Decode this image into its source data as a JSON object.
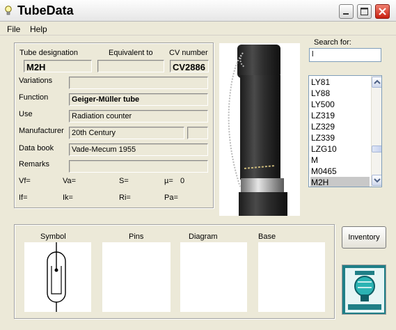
{
  "window": {
    "title": "TubeData"
  },
  "menu": {
    "file": "File",
    "help": "Help"
  },
  "labels": {
    "tube_designation": "Tube designation",
    "equivalent_to": "Equivalent to",
    "cv_number": "CV number",
    "variations": "Variations",
    "function": "Function",
    "use": "Use",
    "manufacturer": "Manufacturer",
    "data_book": "Data book",
    "remarks": "Remarks"
  },
  "values": {
    "tube_designation": "M2H",
    "equivalent_to": "",
    "cv_number": "CV2886",
    "variations": "",
    "function": "Geiger-Müller tube",
    "use": "Radiation counter",
    "manufacturer": "20th Century",
    "manufacturer_extra": "",
    "data_book": "Vade-Mecum 1955",
    "remarks": ""
  },
  "params": {
    "vf": "Vf=",
    "va": "Va=",
    "s": "S=",
    "mu": "µ=",
    "mu_value": "0",
    "if": "If=",
    "ik": "Ik=",
    "ri": "Ri=",
    "pa": "Pa="
  },
  "search": {
    "label": "Search for:",
    "value": "l"
  },
  "tube_list": {
    "items": [
      "LY81",
      "LY88",
      "LY500",
      "LZ319",
      "LZ329",
      "LZ339",
      "LZG10",
      "M",
      "M0465",
      "M2H"
    ],
    "selected": "M2H"
  },
  "panels": {
    "symbol": "Symbol",
    "pins": "Pins",
    "diagram": "Diagram",
    "base": "Base"
  },
  "buttons": {
    "inventory": "Inventory"
  },
  "colors": {
    "window_bg": "#ece9d8",
    "close_button": "#d9341f",
    "selection": "#c8c8c8"
  }
}
